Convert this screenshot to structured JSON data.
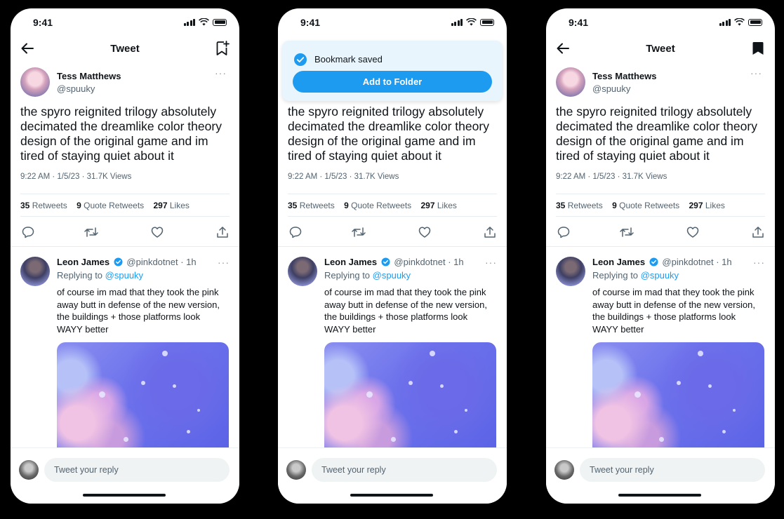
{
  "status": {
    "time": "9:41"
  },
  "nav": {
    "title": "Tweet"
  },
  "tweet": {
    "author_name": "Tess Matthews",
    "author_handle": "@spuuky",
    "more": "···",
    "text": "the spyro reignited trilogy absolutely decimated the dreamlike color theory design of the original game and im tired of staying quiet about it",
    "meta": "9:22 AM · 1/5/23 · 31.7K Views",
    "retweets_count": "35",
    "retweets_label": "Retweets",
    "quote_count": "9",
    "quote_label": "Quote Retweets",
    "likes_count": "297",
    "likes_label": "Likes"
  },
  "reply": {
    "name": "Leon James",
    "handle": "@pinkdotnet",
    "time": "· 1h",
    "replying_label": "Replying to",
    "replying_mention": "@spuuky",
    "text": "of course im mad that they took the pink away butt in defense of the new version, the buildings + those platforms look WAYY better"
  },
  "composer": {
    "placeholder": "Tweet your reply"
  },
  "toast": {
    "message": "Bookmark saved",
    "button": "Add to Folder"
  },
  "icons": {
    "back": "arrow-left-icon",
    "bookmark_add": "bookmark-plus-icon",
    "bookmark_filled": "bookmark-filled-icon",
    "reply": "reply-icon",
    "retweet": "retweet-icon",
    "like": "heart-icon",
    "share": "share-icon",
    "verified": "verified-badge-icon",
    "check": "check-circle-icon"
  },
  "colors": {
    "accent": "#1d9bf0",
    "text": "#0f1419",
    "muted": "#536471",
    "toast_bg": "#e8f5fd"
  },
  "screens": [
    {
      "id": "screen-1",
      "state": "unbookmarked"
    },
    {
      "id": "screen-2",
      "state": "toast-shown"
    },
    {
      "id": "screen-3",
      "state": "bookmarked"
    }
  ]
}
